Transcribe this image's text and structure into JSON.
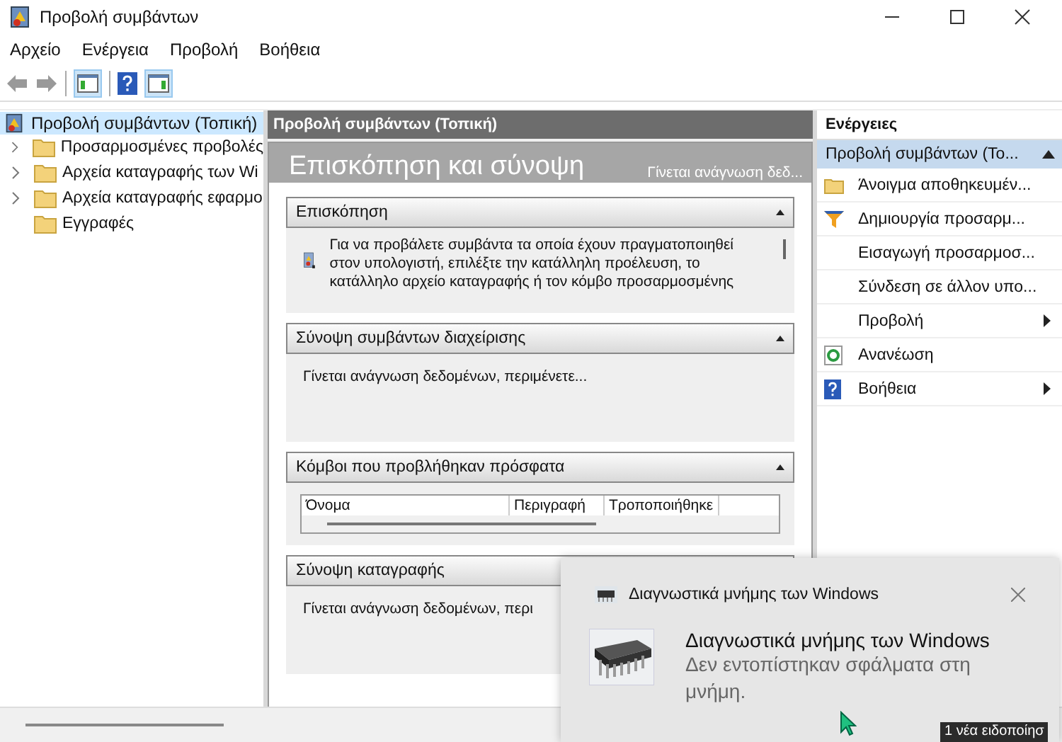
{
  "window": {
    "title": "Προβολή συμβάντων"
  },
  "menu": [
    {
      "label": "Αρχείο"
    },
    {
      "label": "Ενέργεια"
    },
    {
      "label": "Προβολή"
    },
    {
      "label": "Βοήθεια"
    }
  ],
  "tree": {
    "label": "Προβολή συμβάντων (Τοπική)",
    "selected": true,
    "children": [
      {
        "label": "Προσαρμοσμένες προβολές",
        "expandable": true
      },
      {
        "label": "Αρχεία καταγραφής των Wi",
        "expandable": true
      },
      {
        "label": "Αρχεία καταγραφής εφαρμο",
        "expandable": true
      },
      {
        "label": "Εγγραφές",
        "expandable": false
      }
    ]
  },
  "center": {
    "header": "Προβολή συμβάντων (Τοπική)",
    "title": "Επισκόπηση και σύνοψη",
    "status": "Γίνεται ανάγνωση δεδ...",
    "sections": [
      {
        "kind": "intro",
        "title": "Επισκόπηση",
        "expanded": true,
        "text": "Για να προβάλετε συμβάντα τα οποία έχουν πραγματοποιηθεί στον υπολογιστή, επιλέξτε την κατάλληλη προέλευση, το κατάλληλο αρχείο καταγραφής ή τον κόμβο προσαρμοσμένης"
      },
      {
        "kind": "text",
        "title": "Σύνοψη συμβάντων διαχείρισης",
        "expanded": true,
        "text": "Γίνεται ανάγνωση δεδομένων, περιμένετε..."
      },
      {
        "kind": "table",
        "title": "Κόμβοι που προβλήθηκαν πρόσφατα",
        "expanded": true,
        "columns": [
          "Όνομα",
          "Περιγραφή",
          "Τροποποιήθηκε"
        ]
      },
      {
        "kind": "text",
        "title": "Σύνοψη καταγραφής",
        "expanded": true,
        "text": "Γίνεται ανάγνωση δεδομένων, περι"
      }
    ]
  },
  "actions": {
    "title": "Ενέργειες",
    "group": {
      "label": "Προβολή συμβάντων (Το...",
      "expanded": true
    },
    "items": [
      {
        "kind": "folder",
        "label": "Άνοιγμα αποθηκευμέν...",
        "submenu": false
      },
      {
        "kind": "funnel",
        "label": "Δημιουργία προσαρμ...",
        "submenu": false
      },
      {
        "kind": "plain",
        "label": "Εισαγωγή προσαρμοσ...",
        "submenu": false
      },
      {
        "kind": "plain",
        "label": "Σύνδεση σε άλλον υπο...",
        "submenu": false
      },
      {
        "kind": "plain",
        "label": "Προβολή",
        "submenu": true
      },
      {
        "kind": "refresh",
        "label": "Ανανέωση",
        "submenu": false
      },
      {
        "kind": "help",
        "label": "Βοήθεια",
        "submenu": true
      }
    ]
  },
  "notification": {
    "app": "Διαγνωστικά μνήμης των Windows",
    "title": "Διαγνωστικά μνήμης των Windows",
    "message": "Δεν εντοπίστηκαν σφάλματα στη μνήμη."
  },
  "tooltip": "1 νέα ειδοποίησ"
}
